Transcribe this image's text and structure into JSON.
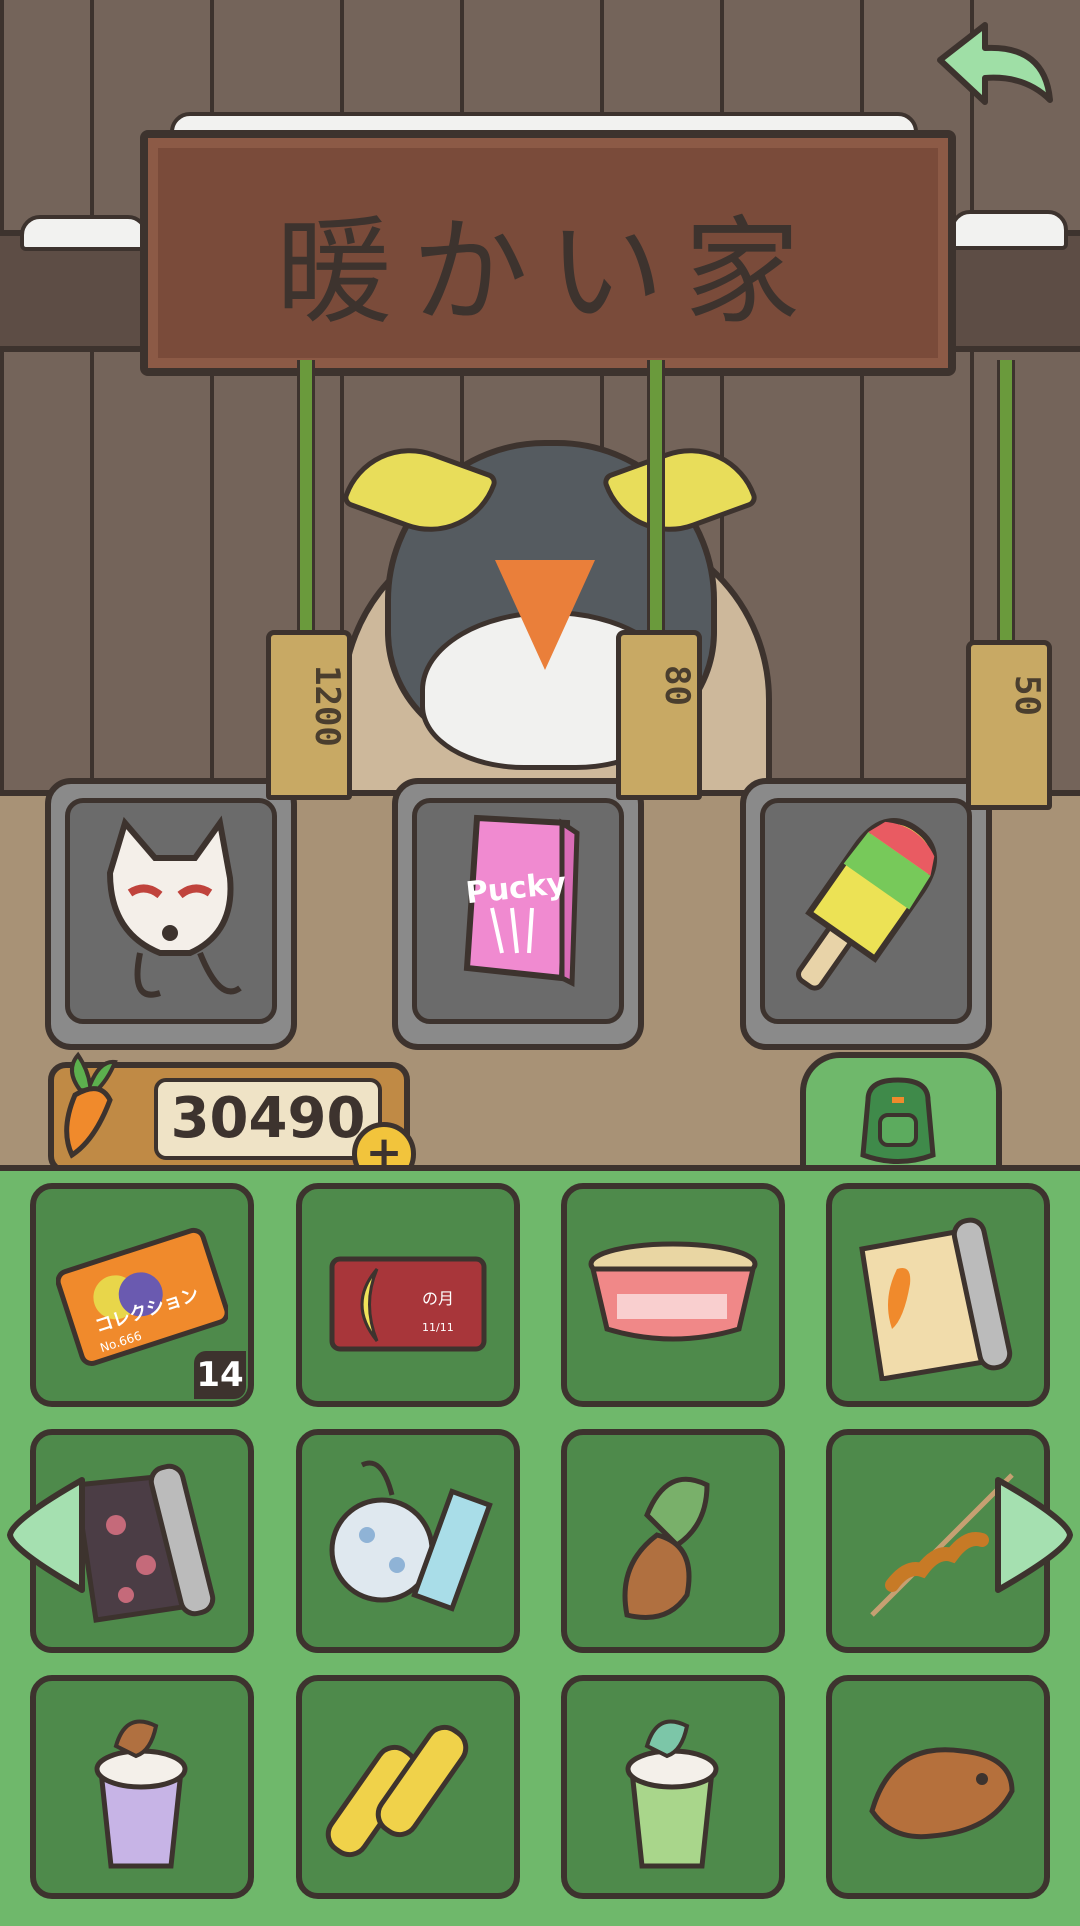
{
  "shop": {
    "sign_title": "暖かい家",
    "items_for_sale": [
      {
        "name": "fox-mask",
        "price": "1200"
      },
      {
        "name": "pucky-box",
        "price": "80",
        "label": "Pucky"
      },
      {
        "name": "popsicle",
        "price": "50"
      }
    ]
  },
  "currency": {
    "icon": "carrot-icon",
    "amount": "30490"
  },
  "inventory": {
    "items": [
      {
        "name": "collection-ticket",
        "text": "コレクション",
        "serial": "No.666",
        "count": "14"
      },
      {
        "name": "moon-card",
        "text": "の月",
        "date": "11/11"
      },
      {
        "name": "cup-noodle"
      },
      {
        "name": "carrot-poster-scroll"
      },
      {
        "name": "sakura-scroll"
      },
      {
        "name": "wind-chime"
      },
      {
        "name": "taiyaki-ice-cream"
      },
      {
        "name": "tornado-potato"
      },
      {
        "name": "taiyaki-drink-pink"
      },
      {
        "name": "grilled-corn"
      },
      {
        "name": "taiyaki-drink-green"
      },
      {
        "name": "taiyaki"
      }
    ]
  },
  "colors": {
    "panel_green": "#6fb86b",
    "cell_green": "#4e8a4b",
    "outline": "#3d332e",
    "wood_sign": "#7a4b3a",
    "accent_yellow": "#f2c43c"
  }
}
